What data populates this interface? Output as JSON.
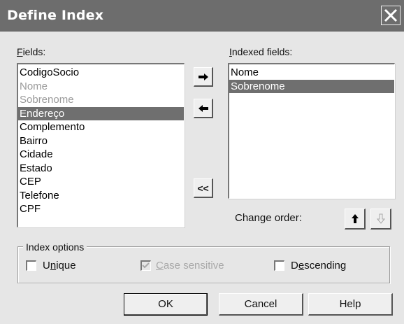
{
  "window": {
    "title": "Define Index"
  },
  "fields": {
    "label_hot": "F",
    "label_rest": "ields:",
    "items": [
      {
        "label": "CodigoSocio",
        "state": "normal"
      },
      {
        "label": "Nome",
        "state": "disabled"
      },
      {
        "label": "Sobrenome",
        "state": "disabled"
      },
      {
        "label": "Endereço",
        "state": "selected"
      },
      {
        "label": "Complemento",
        "state": "normal"
      },
      {
        "label": "Bairro",
        "state": "normal"
      },
      {
        "label": "Cidade",
        "state": "normal"
      },
      {
        "label": "Estado",
        "state": "normal"
      },
      {
        "label": "CEP",
        "state": "normal"
      },
      {
        "label": "Telefone",
        "state": "normal"
      },
      {
        "label": "CPF",
        "state": "normal"
      }
    ]
  },
  "indexed": {
    "label_hot": "I",
    "label_rest": "ndexed fields:",
    "items": [
      {
        "label": "Nome",
        "state": "normal"
      },
      {
        "label": "Sobrenome",
        "state": "selected"
      }
    ]
  },
  "move_buttons": {
    "add_icon": "arrow-right-icon",
    "remove_icon": "arrow-left-icon",
    "remove_all_label": "<<"
  },
  "change_order": {
    "label": "Change order:",
    "up_icon": "arrow-up-icon",
    "down_icon": "arrow-down-icon"
  },
  "index_options": {
    "title": "Index options",
    "unique": {
      "pre": "U",
      "hot": "n",
      "post": "ique",
      "checked": false,
      "enabled": true
    },
    "case_sensitive": {
      "pre": "",
      "hot": "C",
      "post": "ase sensitive",
      "checked": true,
      "enabled": false
    },
    "descending": {
      "pre": "D",
      "hot": "e",
      "post": "scending",
      "checked": false,
      "enabled": true
    }
  },
  "buttons": {
    "ok": "OK",
    "cancel": "Cancel",
    "help": "Help"
  },
  "colors": {
    "title_bar": "#6d6d6d",
    "dialog_bg": "#e6e6e6",
    "selection": "#6f6f6f"
  }
}
